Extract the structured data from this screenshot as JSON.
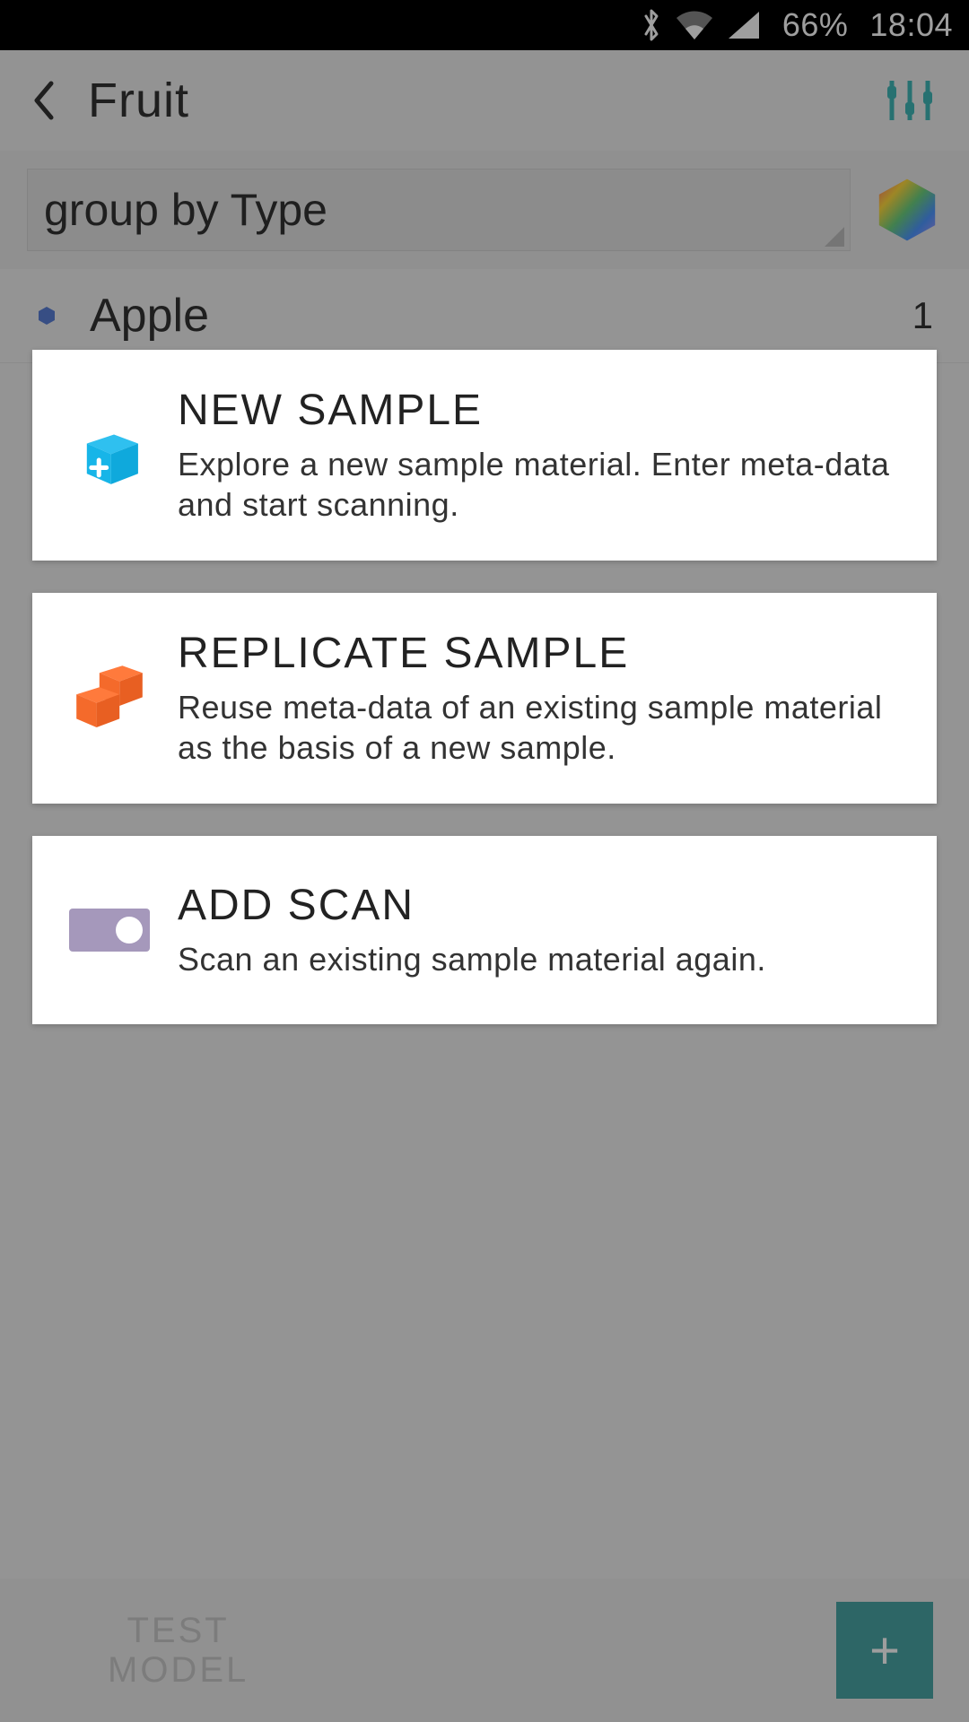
{
  "status": {
    "battery": "66%",
    "time": "18:04"
  },
  "header": {
    "title": "Fruit"
  },
  "filter": {
    "groupByLabel": "group by Type"
  },
  "list": {
    "items": [
      {
        "label": "Apple",
        "count": "1"
      }
    ]
  },
  "bottom": {
    "testModel": "TEST\nMODEL",
    "fab": "+"
  },
  "modal": {
    "options": [
      {
        "title": "NEW SAMPLE",
        "desc": "Explore a new sample material. Enter meta-data and start scanning."
      },
      {
        "title": "REPLICATE SAMPLE",
        "desc": "Reuse meta-data of an existing sample material as the basis of a new sample."
      },
      {
        "title": "ADD SCAN",
        "desc": "Scan an existing sample material again."
      }
    ]
  }
}
